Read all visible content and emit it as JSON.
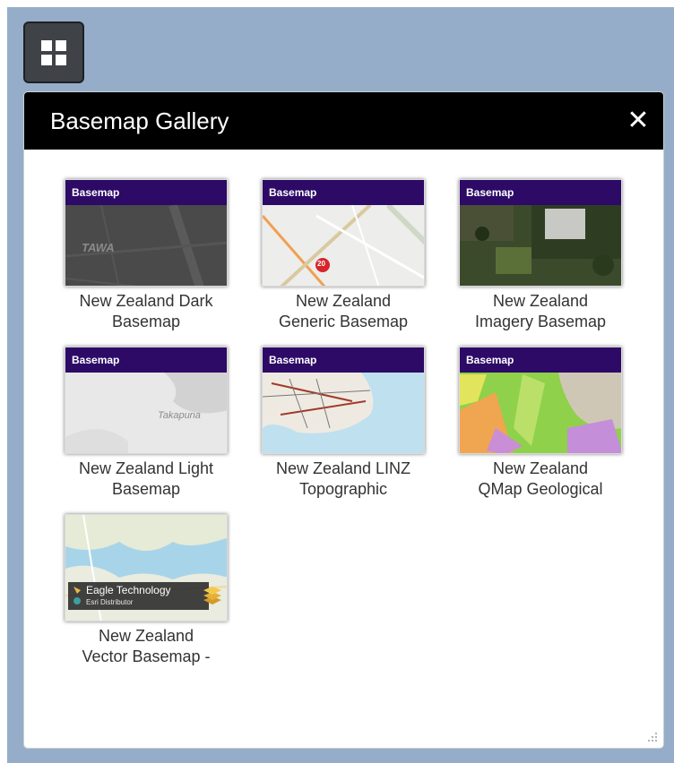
{
  "panel": {
    "title": "Basemap Gallery",
    "close_icon": "close-icon",
    "toggle_icon": "basemap-grid-icon"
  },
  "colors": {
    "map_background": "#95adc8",
    "header_background": "#000000",
    "tag_background": "#2c0a66",
    "toggle_background": "#3f4348"
  },
  "basemaps": [
    {
      "tag": "Basemap",
      "title": "New Zealand Dark Basemap",
      "line1": "New Zealand Dark",
      "line2": "Basemap",
      "thumb_text": "TAWA"
    },
    {
      "tag": "Basemap",
      "title": "New Zealand Generic Basemap",
      "line1": "New Zealand",
      "line2": "Generic Basemap",
      "thumb_text": "20"
    },
    {
      "tag": "Basemap",
      "title": "New Zealand Imagery Basemap",
      "line1": "New Zealand",
      "line2": "Imagery Basemap"
    },
    {
      "tag": "Basemap",
      "title": "New Zealand Light Basemap",
      "line1": "New Zealand Light",
      "line2": "Basemap",
      "thumb_text": "Takapuna"
    },
    {
      "tag": "Basemap",
      "title": "New Zealand LINZ Topographic",
      "line1": "New Zealand LINZ",
      "line2": "Topographic"
    },
    {
      "tag": "Basemap",
      "title": "New Zealand QMap Geological",
      "line1": "New Zealand",
      "line2": "QMap Geological"
    },
    {
      "title": "New Zealand Vector Basemap -",
      "line1": "New Zealand",
      "line2": "Vector Basemap -",
      "logo_name": "Eagle Technology",
      "logo_sub": "Esri Distributor"
    }
  ]
}
